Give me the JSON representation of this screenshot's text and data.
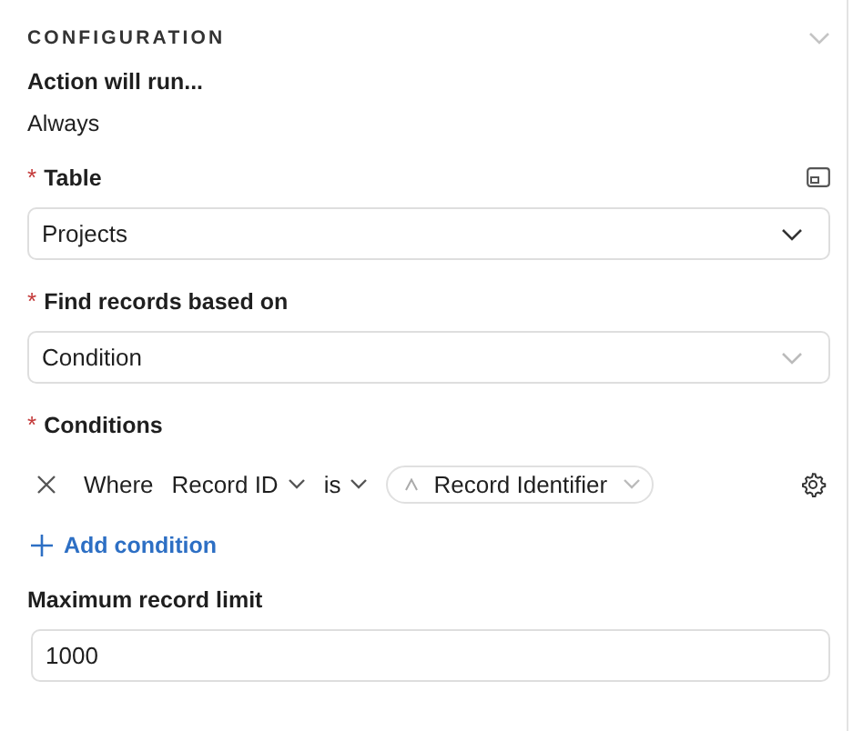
{
  "section": {
    "title": "CONFIGURATION",
    "expanded": true
  },
  "run_when": {
    "label": "Action will run...",
    "value": "Always"
  },
  "fields": [
    {
      "kind": "select",
      "label": "Table",
      "required_mark": "*",
      "side_icon": true,
      "value": "Projects"
    },
    {
      "kind": "select",
      "label": "Find records based on",
      "required_mark": "*",
      "side_icon": false,
      "value": "Condition"
    },
    {
      "kind": "conditions",
      "label": "Conditions",
      "required_mark": "*",
      "side_icon": false,
      "conditions": [
        {
          "prefix": "Where",
          "field": "Record ID",
          "operator": "is",
          "value": "Record Identifier"
        }
      ],
      "add_label": "Add condition"
    },
    {
      "kind": "input",
      "label": "Maximum record limit",
      "side_icon": false,
      "value": "1000"
    }
  ]
}
